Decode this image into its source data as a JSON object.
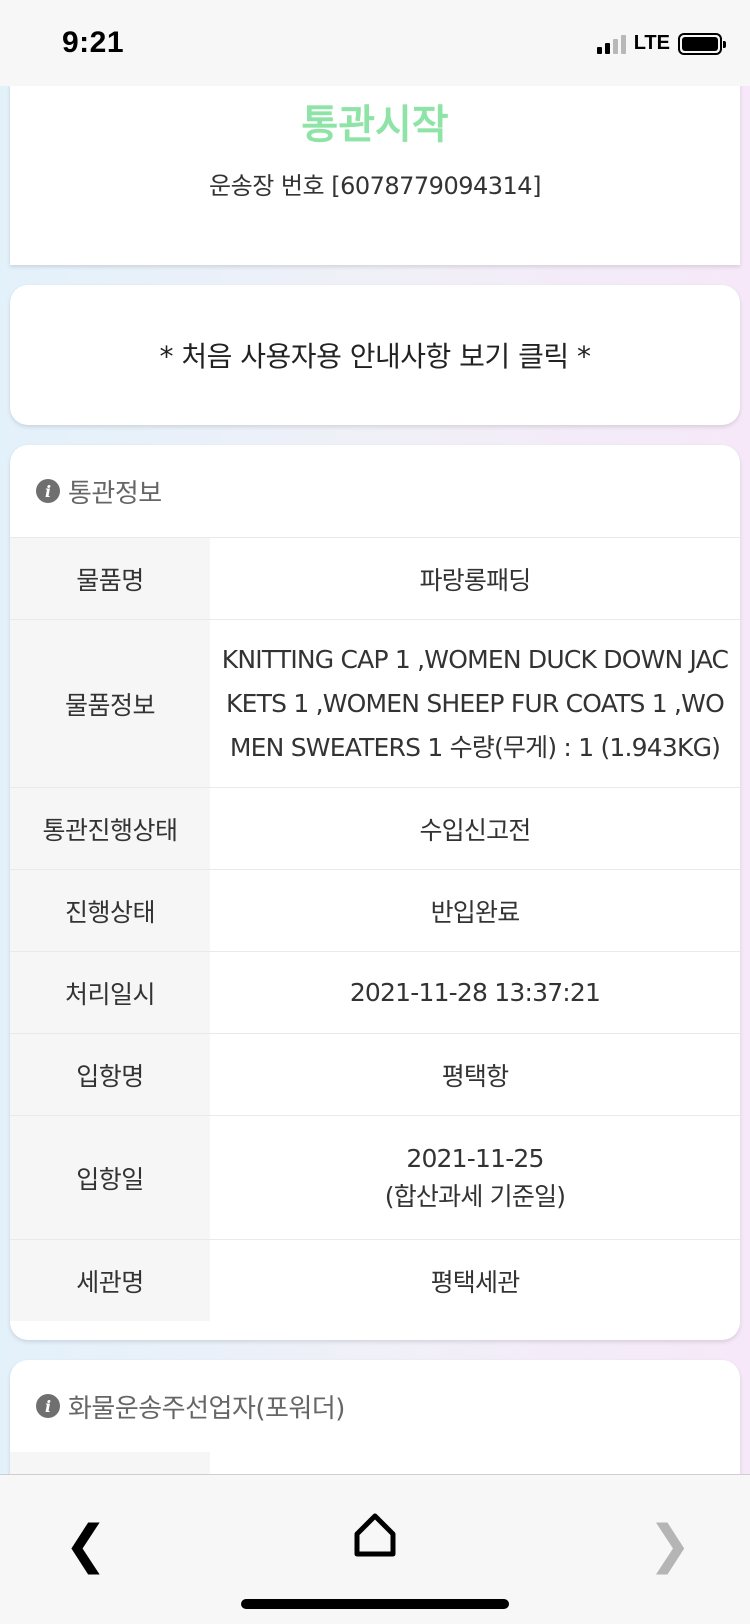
{
  "status_bar": {
    "time": "9:21",
    "network": "LTE"
  },
  "header_card": {
    "status_title": "통관시작",
    "waybill": "운송장 번호 [6078779094314]",
    "accent_color": "#8ee3a6"
  },
  "guide": {
    "text": "* 처음 사용자용 안내사항 보기 클릭 *"
  },
  "customs_info": {
    "section_title": "통관정보",
    "rows": [
      {
        "label": "물품명",
        "value": "파랑롱패딩"
      },
      {
        "label": "물품정보",
        "value": "KNITTING CAP 1 ,WOMEN DUCK DOWN JACKETS 1 ,WOMEN SHEEP FUR COATS 1 ,WOMEN SWEATERS 1 수량(무게) : 1 (1.943KG)"
      },
      {
        "label": "통관진행상태",
        "value": "수입신고전"
      },
      {
        "label": "진행상태",
        "value": "반입완료"
      },
      {
        "label": "처리일시",
        "value": "2021-11-28 13:37:21"
      },
      {
        "label": "입항명",
        "value": "평택항"
      },
      {
        "label": "입항일",
        "value": "2021-11-25",
        "value_note": "(합산과세 기준일)"
      },
      {
        "label": "세관명",
        "value": "평택세관"
      }
    ]
  },
  "forwarder": {
    "section_title": "화물운송주선업자(포워더)"
  },
  "bottom_nav": {
    "back_icon": "chevron-left-icon",
    "home_icon": "home-icon",
    "forward_icon": "chevron-right-icon"
  }
}
